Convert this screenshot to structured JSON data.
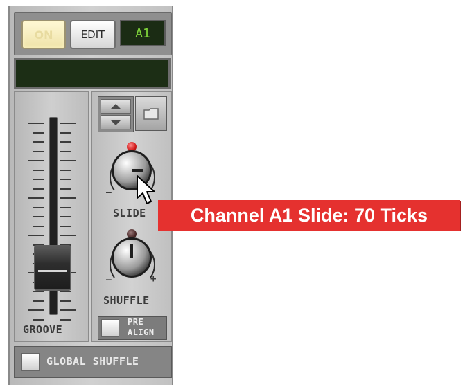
{
  "device": {
    "on_label": "ON",
    "edit_label": "EDIT",
    "channel_display": "A1",
    "patch_display": "",
    "groove_label": "GROOVE",
    "slide_label": "SLIDE",
    "shuffle_label": "SHUFFLE",
    "knob_min": "–",
    "knob_max": "+",
    "pre_align_line1": "PRE",
    "pre_align_line2": "ALIGN",
    "global_shuffle_label": "GLOBAL SHUFFLE",
    "groove_fader_level": 0.15
  },
  "tooltip": {
    "text": "Channel A1 Slide: 70 Ticks"
  },
  "colors": {
    "tooltip_bg": "#e5312f",
    "lcd_text": "#7fd43a",
    "slide_led": "#e02020",
    "shuffle_led": "#5a3a3a"
  },
  "icons": {
    "up": "up-arrow-icon",
    "down": "down-arrow-icon",
    "folder": "folder-icon",
    "cursor": "mouse-pointer-icon"
  }
}
